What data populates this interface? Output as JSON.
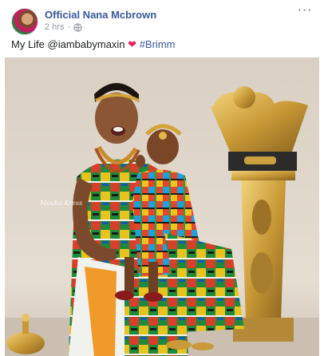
{
  "post": {
    "author": "Official Nana Mcbrown",
    "timestamp": "2 hrs",
    "separator": "·",
    "privacy_icon": "globe-icon",
    "more_label": "···",
    "caption": {
      "text": "My Life",
      "mention": "@iambabymaxin",
      "heart": "❤",
      "hashtag": "#Brimm"
    },
    "photo": {
      "watermark": "Mouka Kress"
    }
  },
  "colors": {
    "link": "#385898",
    "meta": "#90949c",
    "heart": "#e0245e"
  }
}
